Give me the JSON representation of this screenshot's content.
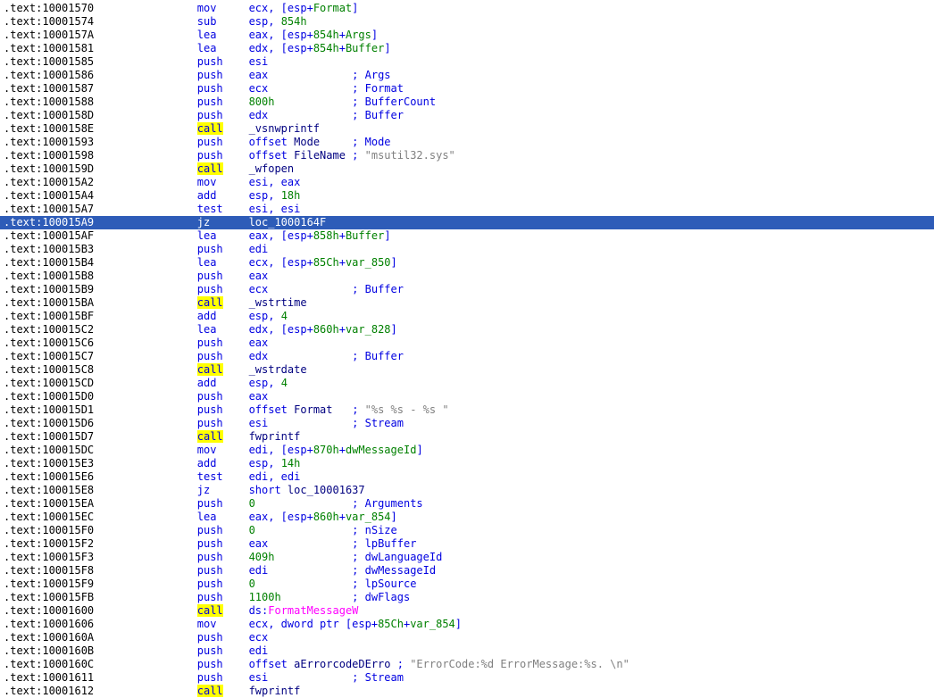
{
  "colors": {
    "background": "#ffffff",
    "address": "#000000",
    "instruction": "#0000e1",
    "number": "#008000",
    "local_name": "#008000",
    "global_name": "#000080",
    "import_name": "#ff00ff",
    "comment": "#0000e1",
    "string": "#808080",
    "selection_bg": "#2e5cb8",
    "selection_fg": "#ffffff",
    "word_highlight": "#ffff00"
  },
  "listing": {
    "segment": ".text",
    "selected_address": ".text:100015A9",
    "highlighted_word": "call",
    "lines": [
      {
        "a": ".text:10001570",
        "m": "mov",
        "o": [
          [
            "i",
            "ecx, [esp+"
          ],
          [
            "l",
            "Format"
          ],
          [
            "i",
            "]"
          ]
        ]
      },
      {
        "a": ".text:10001574",
        "m": "sub",
        "o": [
          [
            "i",
            "esp, "
          ],
          [
            "n",
            "854h"
          ]
        ]
      },
      {
        "a": ".text:1000157A",
        "m": "lea",
        "o": [
          [
            "i",
            "eax, [esp+"
          ],
          [
            "n",
            "854h"
          ],
          [
            "i",
            "+"
          ],
          [
            "l",
            "Args"
          ],
          [
            "i",
            "]"
          ]
        ]
      },
      {
        "a": ".text:10001581",
        "m": "lea",
        "o": [
          [
            "i",
            "edx, [esp+"
          ],
          [
            "n",
            "854h"
          ],
          [
            "i",
            "+"
          ],
          [
            "l",
            "Buffer"
          ],
          [
            "i",
            "]"
          ]
        ]
      },
      {
        "a": ".text:10001585",
        "m": "push",
        "o": [
          [
            "i",
            "esi"
          ]
        ]
      },
      {
        "a": ".text:10001586",
        "m": "push",
        "o": [
          [
            "i",
            "eax"
          ]
        ],
        "c": [
          [
            "c",
            "; Args"
          ]
        ]
      },
      {
        "a": ".text:10001587",
        "m": "push",
        "o": [
          [
            "i",
            "ecx"
          ]
        ],
        "c": [
          [
            "c",
            "; Format"
          ]
        ]
      },
      {
        "a": ".text:10001588",
        "m": "push",
        "o": [
          [
            "n",
            "800h"
          ]
        ],
        "c": [
          [
            "c",
            "; BufferCount"
          ]
        ]
      },
      {
        "a": ".text:1000158D",
        "m": "push",
        "o": [
          [
            "i",
            "edx"
          ]
        ],
        "c": [
          [
            "c",
            "; Buffer"
          ]
        ]
      },
      {
        "a": ".text:1000158E",
        "m": "call",
        "hl": true,
        "o": [
          [
            "d",
            "_vsnwprintf"
          ]
        ]
      },
      {
        "a": ".text:10001593",
        "m": "push",
        "o": [
          [
            "i",
            "offset "
          ],
          [
            "d",
            "Mode"
          ]
        ],
        "c": [
          [
            "c",
            "; Mode"
          ]
        ]
      },
      {
        "a": ".text:10001598",
        "m": "push",
        "o": [
          [
            "i",
            "offset "
          ],
          [
            "d",
            "FileName"
          ]
        ],
        "c": [
          [
            "c",
            "; "
          ],
          [
            "s",
            "\"msutil32.sys\""
          ]
        ]
      },
      {
        "a": ".text:1000159D",
        "m": "call",
        "hl": true,
        "o": [
          [
            "d",
            "_wfopen"
          ]
        ]
      },
      {
        "a": ".text:100015A2",
        "m": "mov",
        "o": [
          [
            "i",
            "esi, eax"
          ]
        ]
      },
      {
        "a": ".text:100015A4",
        "m": "add",
        "o": [
          [
            "i",
            "esp, "
          ],
          [
            "n",
            "18h"
          ]
        ]
      },
      {
        "a": ".text:100015A7",
        "m": "test",
        "o": [
          [
            "i",
            "esi, esi"
          ]
        ]
      },
      {
        "a": ".text:100015A9",
        "m": "jz",
        "sel": true,
        "o": [
          [
            "d",
            "loc_1000164F"
          ]
        ]
      },
      {
        "a": ".text:100015AF",
        "m": "lea",
        "o": [
          [
            "i",
            "eax, [esp+"
          ],
          [
            "n",
            "858h"
          ],
          [
            "i",
            "+"
          ],
          [
            "l",
            "Buffer"
          ],
          [
            "i",
            "]"
          ]
        ]
      },
      {
        "a": ".text:100015B3",
        "m": "push",
        "o": [
          [
            "i",
            "edi"
          ]
        ]
      },
      {
        "a": ".text:100015B4",
        "m": "lea",
        "o": [
          [
            "i",
            "ecx, [esp+"
          ],
          [
            "n",
            "85Ch"
          ],
          [
            "i",
            "+"
          ],
          [
            "l",
            "var_850"
          ],
          [
            "i",
            "]"
          ]
        ]
      },
      {
        "a": ".text:100015B8",
        "m": "push",
        "o": [
          [
            "i",
            "eax"
          ]
        ]
      },
      {
        "a": ".text:100015B9",
        "m": "push",
        "o": [
          [
            "i",
            "ecx"
          ]
        ],
        "c": [
          [
            "c",
            "; Buffer"
          ]
        ]
      },
      {
        "a": ".text:100015BA",
        "m": "call",
        "hl": true,
        "o": [
          [
            "d",
            "_wstrtime"
          ]
        ]
      },
      {
        "a": ".text:100015BF",
        "m": "add",
        "o": [
          [
            "i",
            "esp, "
          ],
          [
            "n",
            "4"
          ]
        ]
      },
      {
        "a": ".text:100015C2",
        "m": "lea",
        "o": [
          [
            "i",
            "edx, [esp+"
          ],
          [
            "n",
            "860h"
          ],
          [
            "i",
            "+"
          ],
          [
            "l",
            "var_828"
          ],
          [
            "i",
            "]"
          ]
        ]
      },
      {
        "a": ".text:100015C6",
        "m": "push",
        "o": [
          [
            "i",
            "eax"
          ]
        ]
      },
      {
        "a": ".text:100015C7",
        "m": "push",
        "o": [
          [
            "i",
            "edx"
          ]
        ],
        "c": [
          [
            "c",
            "; Buffer"
          ]
        ]
      },
      {
        "a": ".text:100015C8",
        "m": "call",
        "hl": true,
        "o": [
          [
            "d",
            "_wstrdate"
          ]
        ]
      },
      {
        "a": ".text:100015CD",
        "m": "add",
        "o": [
          [
            "i",
            "esp, "
          ],
          [
            "n",
            "4"
          ]
        ]
      },
      {
        "a": ".text:100015D0",
        "m": "push",
        "o": [
          [
            "i",
            "eax"
          ]
        ]
      },
      {
        "a": ".text:100015D1",
        "m": "push",
        "o": [
          [
            "i",
            "offset "
          ],
          [
            "d",
            "Format"
          ]
        ],
        "c": [
          [
            "c",
            "; "
          ],
          [
            "s",
            "\"%s %s - %s \""
          ]
        ]
      },
      {
        "a": ".text:100015D6",
        "m": "push",
        "o": [
          [
            "i",
            "esi"
          ]
        ],
        "c": [
          [
            "c",
            "; Stream"
          ]
        ]
      },
      {
        "a": ".text:100015D7",
        "m": "call",
        "hl": true,
        "o": [
          [
            "d",
            "fwprintf"
          ]
        ]
      },
      {
        "a": ".text:100015DC",
        "m": "mov",
        "o": [
          [
            "i",
            "edi, [esp+"
          ],
          [
            "n",
            "870h"
          ],
          [
            "i",
            "+"
          ],
          [
            "l",
            "dwMessageId"
          ],
          [
            "i",
            "]"
          ]
        ]
      },
      {
        "a": ".text:100015E3",
        "m": "add",
        "o": [
          [
            "i",
            "esp, "
          ],
          [
            "n",
            "14h"
          ]
        ]
      },
      {
        "a": ".text:100015E6",
        "m": "test",
        "o": [
          [
            "i",
            "edi, edi"
          ]
        ]
      },
      {
        "a": ".text:100015E8",
        "m": "jz",
        "o": [
          [
            "i",
            "short "
          ],
          [
            "d",
            "loc_10001637"
          ]
        ]
      },
      {
        "a": ".text:100015EA",
        "m": "push",
        "o": [
          [
            "n",
            "0"
          ]
        ],
        "c": [
          [
            "c",
            "; Arguments"
          ]
        ]
      },
      {
        "a": ".text:100015EC",
        "m": "lea",
        "o": [
          [
            "i",
            "eax, [esp+"
          ],
          [
            "n",
            "860h"
          ],
          [
            "i",
            "+"
          ],
          [
            "l",
            "var_854"
          ],
          [
            "i",
            "]"
          ]
        ]
      },
      {
        "a": ".text:100015F0",
        "m": "push",
        "o": [
          [
            "n",
            "0"
          ]
        ],
        "c": [
          [
            "c",
            "; nSize"
          ]
        ]
      },
      {
        "a": ".text:100015F2",
        "m": "push",
        "o": [
          [
            "i",
            "eax"
          ]
        ],
        "c": [
          [
            "c",
            "; lpBuffer"
          ]
        ]
      },
      {
        "a": ".text:100015F3",
        "m": "push",
        "o": [
          [
            "n",
            "409h"
          ]
        ],
        "c": [
          [
            "c",
            "; dwLanguageId"
          ]
        ]
      },
      {
        "a": ".text:100015F8",
        "m": "push",
        "o": [
          [
            "i",
            "edi"
          ]
        ],
        "c": [
          [
            "c",
            "; dwMessageId"
          ]
        ]
      },
      {
        "a": ".text:100015F9",
        "m": "push",
        "o": [
          [
            "n",
            "0"
          ]
        ],
        "c": [
          [
            "c",
            "; lpSource"
          ]
        ]
      },
      {
        "a": ".text:100015FB",
        "m": "push",
        "o": [
          [
            "n",
            "1100h"
          ]
        ],
        "c": [
          [
            "c",
            "; dwFlags"
          ]
        ]
      },
      {
        "a": ".text:10001600",
        "m": "call",
        "hl": true,
        "o": [
          [
            "i",
            "ds:"
          ],
          [
            "m",
            "FormatMessageW"
          ]
        ]
      },
      {
        "a": ".text:10001606",
        "m": "mov",
        "o": [
          [
            "i",
            "ecx, dword ptr [esp+"
          ],
          [
            "n",
            "85Ch"
          ],
          [
            "i",
            "+"
          ],
          [
            "l",
            "var_854"
          ],
          [
            "i",
            "]"
          ]
        ]
      },
      {
        "a": ".text:1000160A",
        "m": "push",
        "o": [
          [
            "i",
            "ecx"
          ]
        ]
      },
      {
        "a": ".text:1000160B",
        "m": "push",
        "o": [
          [
            "i",
            "edi"
          ]
        ]
      },
      {
        "a": ".text:1000160C",
        "m": "push",
        "o": [
          [
            "i",
            "offset "
          ],
          [
            "d",
            "aErrorcodeDErro"
          ]
        ],
        "c": [
          [
            "c",
            "; "
          ],
          [
            "s",
            "\"ErrorCode:%d ErrorMessage:%s. \\n\""
          ]
        ]
      },
      {
        "a": ".text:10001611",
        "m": "push",
        "o": [
          [
            "i",
            "esi"
          ]
        ],
        "c": [
          [
            "c",
            "; Stream"
          ]
        ]
      },
      {
        "a": ".text:10001612",
        "m": "call",
        "hl": true,
        "o": [
          [
            "d",
            "fwprintf"
          ]
        ]
      }
    ]
  }
}
